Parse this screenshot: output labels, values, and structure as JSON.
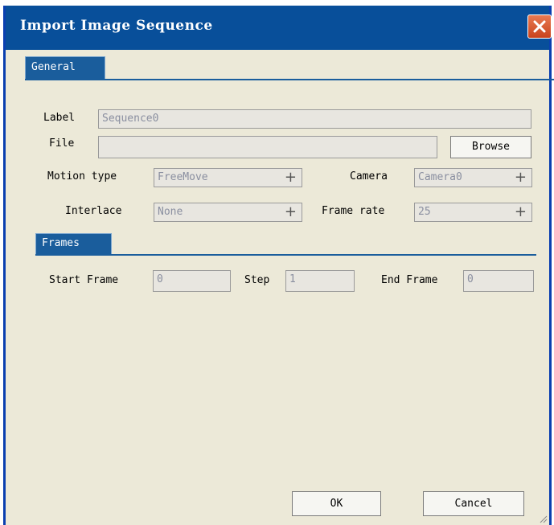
{
  "window": {
    "title": "Import Image Sequence"
  },
  "tabs": {
    "general": "General",
    "frames": "Frames"
  },
  "general": {
    "label": {
      "label": "Label",
      "value": "Sequence0"
    },
    "file": {
      "label": "File",
      "value": "",
      "browse": "Browse"
    },
    "motion_type": {
      "label": "Motion type",
      "value": "FreeMove"
    },
    "camera": {
      "label": "Camera",
      "value": "Camera0"
    },
    "interlace": {
      "label": "Interlace",
      "value": "None"
    },
    "frame_rate": {
      "label": "Frame rate",
      "value": "25"
    }
  },
  "frames": {
    "start_frame": {
      "label": "Start Frame",
      "value": "0"
    },
    "step": {
      "label": "Step",
      "value": "1"
    },
    "end_frame": {
      "label": "End Frame",
      "value": "0"
    }
  },
  "buttons": {
    "ok": "OK",
    "cancel": "Cancel"
  },
  "colors": {
    "titlebar": "#084f9a",
    "dialog_bg": "#ece9d8",
    "tab": "#1a5d9c",
    "close": "#d4562a"
  }
}
